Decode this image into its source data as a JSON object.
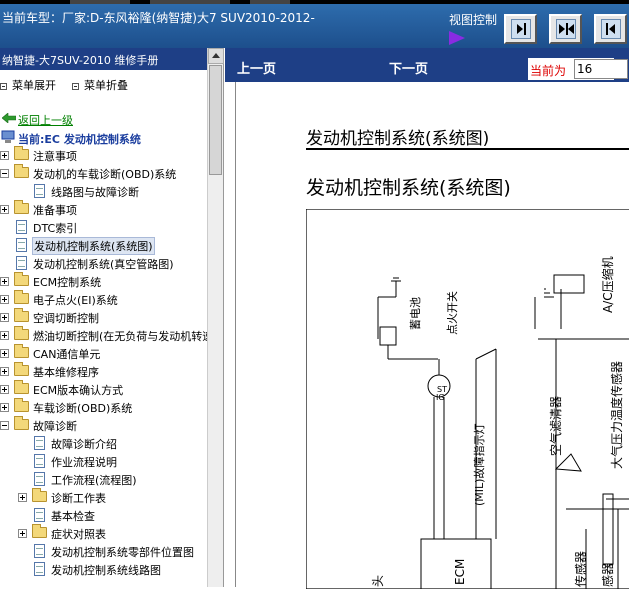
{
  "header": {
    "car_label": "当前车型：厂家:D-东风裕隆(纳智捷)大7 SUV2010-2012-",
    "view_control_label": "视图控制"
  },
  "left_panel": {
    "title": "纳智捷-大7SUV-2010 维修手册",
    "menu_expand": "菜单展开",
    "menu_collapse": "菜单折叠",
    "return_link": "返回上一级",
    "current_label": "当前:EC 发动机控制系统",
    "tree": [
      {
        "label": "注意事项",
        "type": "folder",
        "level": 0,
        "toggle": "plus"
      },
      {
        "label": "发动机的车载诊断(OBD)系统",
        "type": "folder",
        "level": 0,
        "toggle": "minus"
      },
      {
        "label": "线路图与故障诊断",
        "type": "doc",
        "level": 1
      },
      {
        "label": "准备事项",
        "type": "folder",
        "level": 0,
        "toggle": "plus"
      },
      {
        "label": "DTC索引",
        "type": "doc",
        "level": 0
      },
      {
        "label": "发动机控制系统(系统图)",
        "type": "doc",
        "level": 0,
        "selected": true
      },
      {
        "label": "发动机控制系统(真空管路图)",
        "type": "doc",
        "level": 0
      },
      {
        "label": "ECM控制系统",
        "type": "folder",
        "level": 0,
        "toggle": "plus"
      },
      {
        "label": "电子点火(EI)系统",
        "type": "folder",
        "level": 0,
        "toggle": "plus"
      },
      {
        "label": "空调切断控制",
        "type": "folder",
        "level": 0,
        "toggle": "plus"
      },
      {
        "label": "燃油切断控制(在无负荷与发动机转速",
        "type": "folder",
        "level": 0,
        "toggle": "plus"
      },
      {
        "label": "CAN通信单元",
        "type": "folder",
        "level": 0,
        "toggle": "plus"
      },
      {
        "label": "基本维修程序",
        "type": "folder",
        "level": 0,
        "toggle": "plus"
      },
      {
        "label": "ECM版本确认方式",
        "type": "folder",
        "level": 0,
        "toggle": "plus"
      },
      {
        "label": "车载诊断(OBD)系统",
        "type": "folder",
        "level": 0,
        "toggle": "plus"
      },
      {
        "label": "故障诊断",
        "type": "folder",
        "level": 0,
        "toggle": "minus"
      },
      {
        "label": "故障诊断介绍",
        "type": "doc",
        "level": 1
      },
      {
        "label": "作业流程说明",
        "type": "doc",
        "level": 1
      },
      {
        "label": "工作流程(流程图)",
        "type": "doc",
        "level": 1
      },
      {
        "label": "诊断工作表",
        "type": "folder",
        "level": 1,
        "toggle": "plus"
      },
      {
        "label": "基本检查",
        "type": "doc",
        "level": 1
      },
      {
        "label": "症状对照表",
        "type": "folder",
        "level": 1,
        "toggle": "plus"
      },
      {
        "label": "发动机控制系统零部件位置图",
        "type": "doc",
        "level": 1
      },
      {
        "label": "发动机控制系统线路图",
        "type": "doc",
        "level": 1
      }
    ]
  },
  "nav": {
    "prev": "上一页",
    "next": "下一页",
    "current_page_label": "当前为",
    "current_page_value": "16"
  },
  "document": {
    "header_title": "发动机控制系统(系统图)",
    "title": "发动机控制系统(系统图)",
    "diagram_labels": {
      "battery": "蓄电池",
      "ignition_switch": "点火开关",
      "st": "ST",
      "ig": "IG",
      "mil": "(MIL)故障指示灯",
      "ecm": "ECM",
      "ac_compressor": "A/C压缩机",
      "air_cleaner": "空气滤清器",
      "baro_sensor": "大气压力温度传感器",
      "sensor_bottom": "传感器",
      "bottom_left": "头",
      "bottom_mid": "感器"
    }
  },
  "colors": {
    "header_blue": "#2f6fb0",
    "panel_blue": "#1e3f86",
    "link_green": "#008000",
    "current_blue": "#1a3d9e",
    "page_label_red": "#dd0000"
  }
}
